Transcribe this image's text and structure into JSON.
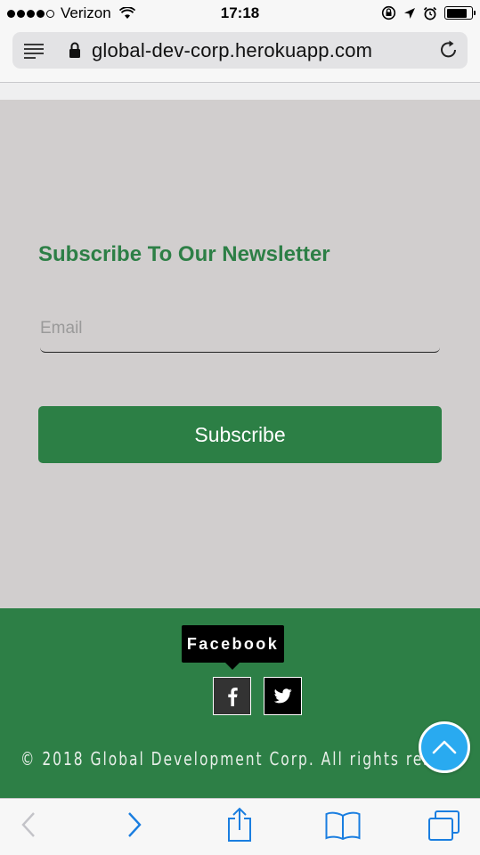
{
  "status_bar": {
    "carrier": "Verizon",
    "time": "17:18",
    "signal_bars_filled": 4,
    "signal_bars_total": 5,
    "battery_level": 0.85
  },
  "address_bar": {
    "url": "global-dev-corp.herokuapp.com"
  },
  "newsletter": {
    "title": "Subscribe To Our Newsletter",
    "email_placeholder": "Email",
    "email_value": "",
    "subscribe_label": "Subscribe"
  },
  "footer": {
    "tooltip_label": "Facebook",
    "social": [
      {
        "name": "facebook",
        "icon": "facebook-icon"
      },
      {
        "name": "twitter",
        "icon": "twitter-icon"
      }
    ],
    "copyright": "© 2018 Global Development Corp. All rights rese"
  },
  "colors": {
    "brand_green": "#2d7f46",
    "newsletter_bg": "#d1cece",
    "back_to_top": "#29aaf0",
    "safari_blue": "#1a7ee0"
  }
}
